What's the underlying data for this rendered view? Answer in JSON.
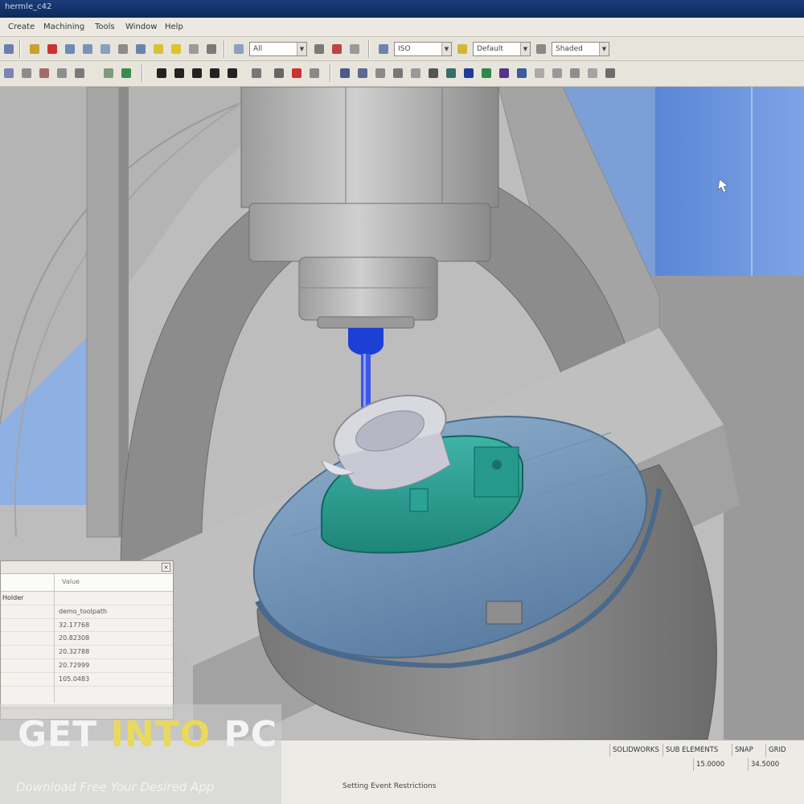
{
  "window": {
    "title": "hermle_c42"
  },
  "menu": {
    "items": [
      "Create",
      "Machining",
      "Tools",
      "Window",
      "Help"
    ]
  },
  "toolbar": {
    "combo_filter": "All",
    "combo_view": "ISO",
    "combo_material": "Default",
    "combo_mode": "Shaded"
  },
  "properties": {
    "columns": {
      "name": "",
      "value": "Value"
    },
    "rows": [
      {
        "label": "Holder",
        "value": ""
      },
      {
        "label": "",
        "value": "demo_toolpath"
      },
      {
        "label": "",
        "value": "32.17768"
      },
      {
        "label": "",
        "value": "20.82308"
      },
      {
        "label": "",
        "value": "20.32788"
      },
      {
        "label": "",
        "value": "20.72999"
      },
      {
        "label": "",
        "value": "105.0483"
      }
    ]
  },
  "status": {
    "message": "Setting Event Restrictions",
    "cells": [
      "SOLIDWORKS",
      "SUB ELEMENTS",
      "SNAP",
      "GRID"
    ],
    "cells2": [
      "15.0000",
      "34.5000"
    ]
  },
  "watermark": {
    "logo_part1": "GET ",
    "logo_part2": "INTO",
    "logo_part3": " PC",
    "tagline": "Download Free Your Desired App"
  }
}
